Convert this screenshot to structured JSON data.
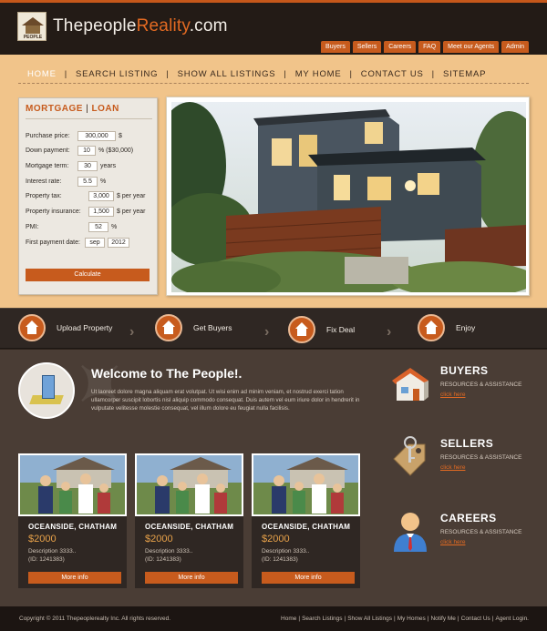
{
  "header": {
    "logo_text": "PEOPLE",
    "title_prefix": "Thepeople",
    "title_highlight": "Reality",
    "title_suffix": ".com",
    "top_links": [
      "Buyers",
      "Sellers",
      "Careers",
      "FAQ",
      "Meet our Agents",
      "Admin"
    ]
  },
  "main_nav": [
    "HOME",
    "SEARCH LISTING",
    "SHOW ALL LISTINGS",
    "MY HOME",
    "CONTACT US",
    "SITEMAP"
  ],
  "mortgage": {
    "title_a": "MORTGAGE",
    "title_sep": " | ",
    "title_b": "LOAN",
    "rows": [
      {
        "label": "Purchase price:",
        "value": "300,000",
        "suffix": "$"
      },
      {
        "label": "Down payment:",
        "value": "10",
        "suffix": "% ($30,000)"
      },
      {
        "label": "Mortgage term:",
        "value": "30",
        "suffix": "years"
      },
      {
        "label": "Interest rate:",
        "value": "5.5",
        "suffix": "%"
      },
      {
        "label": "Property tax:",
        "value": "3,000",
        "suffix": "$ per year"
      },
      {
        "label": "Property insurance:",
        "value": "1,500",
        "suffix": "$ per year"
      },
      {
        "label": "PMI:",
        "value": "52",
        "suffix": "%"
      },
      {
        "label": "First payment date:",
        "value": "sep",
        "value2": "2012",
        "suffix": ""
      }
    ],
    "calculate_label": "Calculate"
  },
  "steps": [
    "Upload Property",
    "Get Buyers",
    "Fix Deal",
    "Enjoy"
  ],
  "welcome": {
    "title": "Welcome to The People!.",
    "body": "Ut laoreet dolore magna aliquam erat volutpat. Ut wisi enim ad minim veniam, et nostrud exerci tation ullamcorper suscipit lobortis nisl aliquip commodo consequat. Duis autem vel eum iriure dolor in hendrerit in vulputate velitesse molestie consequat, vel illum dolore eu feugiat nulla facilisis."
  },
  "right_items": [
    {
      "title": "BUYERS",
      "sub": "RESOURCES & ASSISTANCE",
      "link": "click here",
      "icon": "house-icon"
    },
    {
      "title": "SELLERS",
      "sub": "RESOURCES & ASSISTANCE",
      "link": "click here",
      "icon": "key-tag-icon"
    },
    {
      "title": "CAREERS",
      "sub": "RESOURCES & ASSISTANCE",
      "link": "click here",
      "icon": "person-icon"
    }
  ],
  "listings": [
    {
      "title": "OCEANSIDE, CHATHAM",
      "price": "$2000",
      "desc": "Description 3333..",
      "id": "(ID: 1241383)",
      "button": "More info"
    },
    {
      "title": "OCEANSIDE, CHATHAM",
      "price": "$2000",
      "desc": "Description 3333..",
      "id": "(ID: 1241383)",
      "button": "More info"
    },
    {
      "title": "OCEANSIDE, CHATHAM",
      "price": "$2000",
      "desc": "Description 3333..",
      "id": "(ID: 1241383)",
      "button": "More info"
    }
  ],
  "footer": {
    "copyright": "Copyright © 2011 Thepeoplerealty Inc. All rights reserved.",
    "links": [
      "Home",
      "Search Listings",
      "Show All Listings",
      "My Homes",
      "Notify Me",
      "Contact Us",
      "Agent Login."
    ]
  },
  "colors": {
    "accent": "#c75b1d",
    "band": "#f1c48a",
    "dark": "#2b211b"
  }
}
